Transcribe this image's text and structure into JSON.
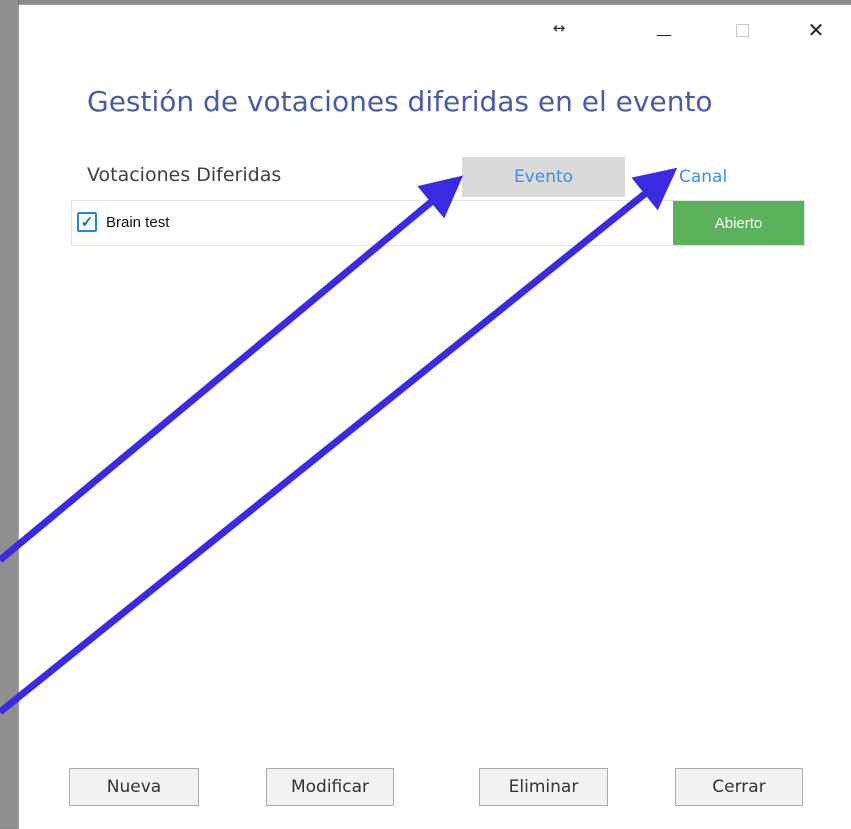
{
  "window": {
    "title": "Gestión de votaciones diferidas en el evento",
    "controls": {
      "resize_icon": "↔",
      "minimize_icon": "minimize-icon",
      "maximize_icon": "maximize-icon",
      "close_icon": "✕"
    }
  },
  "list": {
    "section_label": "Votaciones Diferidas",
    "columns": [
      "Evento",
      "Canal"
    ],
    "rows": [
      {
        "checked": true,
        "check_glyph": "✓",
        "name": "Brain test",
        "status": "Abierto"
      }
    ]
  },
  "buttons": {
    "nueva": "Nueva",
    "modificar": "Modificar",
    "eliminar": "Eliminar",
    "cerrar": "Cerrar"
  },
  "colors": {
    "title": "#4a5ca0",
    "link": "#3e8ee0",
    "status_open": "#5cb25c",
    "annotation_arrow": "#3a2be0"
  }
}
